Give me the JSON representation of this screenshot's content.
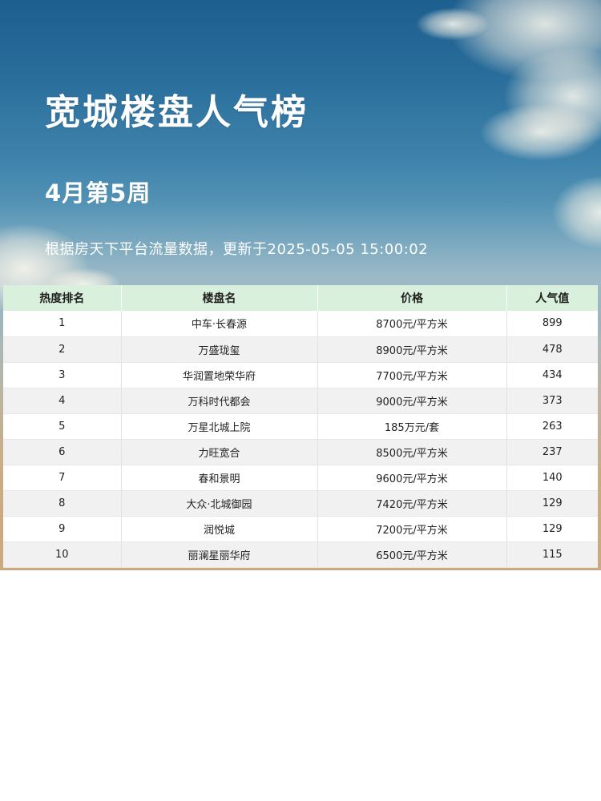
{
  "header": {
    "title": "宽城楼盘人气榜",
    "week": "4月第5周",
    "subtitle": "根据房天下平台流量数据，更新于2025-05-05 15:00:02"
  },
  "table": {
    "columns": [
      "热度排名",
      "楼盘名",
      "价格",
      "人气值"
    ],
    "rows": [
      {
        "rank": "1",
        "name": "中车·长春源",
        "price": "8700元/平方米",
        "popularity": "899"
      },
      {
        "rank": "2",
        "name": "万盛珑玺",
        "price": "8900元/平方米",
        "popularity": "478"
      },
      {
        "rank": "3",
        "name": "华润置地荣华府",
        "price": "7700元/平方米",
        "popularity": "434"
      },
      {
        "rank": "4",
        "name": "万科时代都会",
        "price": "9000元/平方米",
        "popularity": "373"
      },
      {
        "rank": "5",
        "name": "万星北城上院",
        "price": "185万元/套",
        "popularity": "263"
      },
      {
        "rank": "6",
        "name": "力旺宽合",
        "price": "8500元/平方米",
        "popularity": "237"
      },
      {
        "rank": "7",
        "name": "春和景明",
        "price": "9600元/平方米",
        "popularity": "140"
      },
      {
        "rank": "8",
        "name": "大众·北城御园",
        "price": "7420元/平方米",
        "popularity": "129"
      },
      {
        "rank": "9",
        "name": "润悦城",
        "price": "7200元/平方米",
        "popularity": "129"
      },
      {
        "rank": "10",
        "name": "丽澜星丽华府",
        "price": "6500元/平方米",
        "popularity": "115"
      }
    ]
  },
  "colors": {
    "header_row": "#d9f0dc",
    "sky_top": "#1d5f8f",
    "sky_bottom": "#caa882"
  }
}
